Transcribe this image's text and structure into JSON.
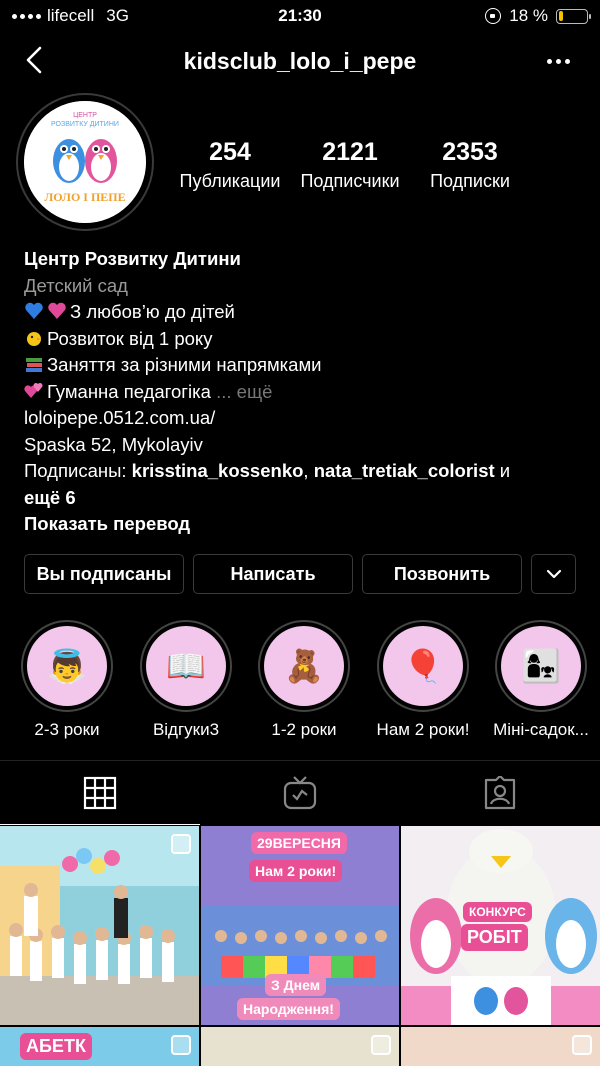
{
  "status_bar": {
    "carrier": "lifecell",
    "network": "3G",
    "time": "21:30",
    "battery_text": "18 %",
    "battery_level": 0.18
  },
  "header": {
    "username": "kidsclub_lolo_i_pepe"
  },
  "stats": [
    {
      "value": "254",
      "label": "Публикации"
    },
    {
      "value": "2121",
      "label": "Подписчики"
    },
    {
      "value": "2353",
      "label": "Подписки"
    }
  ],
  "bio": {
    "name": "Центр Розвитку Дитини",
    "category": "Детский сад",
    "lines": [
      "З любов’ю до дітей",
      "Розвиток від 1 року",
      "Заняття за різними напрямками",
      "Гуманна педагогіка"
    ],
    "more": "... ещё",
    "website": "loloipepe.0512.com.ua/",
    "address": "Spaska 52, Mykolayiv",
    "followed_by_prefix": "Подписаны: ",
    "followed_by_1": "krisstina_kossenko",
    "followed_by_sep": ", ",
    "followed_by_2": "nata_tretiak_colorist",
    "followed_by_suffix": " и",
    "followed_by_more": "ещё 6",
    "translate": "Показать перевод"
  },
  "buttons": {
    "following": "Вы подписаны",
    "message": "Написать",
    "call": "Позвонить",
    "chevron": "⌄"
  },
  "highlights": [
    {
      "label": "2-3 роки",
      "icon": "👼"
    },
    {
      "label": "Відгуки3",
      "icon": "📖"
    },
    {
      "label": "1-2 роки",
      "icon": "🧸"
    },
    {
      "label": "Нам 2 роки!",
      "icon": "🎈"
    },
    {
      "label": "Міні-садок...",
      "icon": "👩‍👧"
    }
  ],
  "tabs": [
    "grid-icon",
    "igtv-icon",
    "tagged-icon"
  ],
  "posts": {
    "post2_date": "29ВЕРЕСНЯ",
    "post2_title": "Нам 2 роки!",
    "post2_footer_1": "З Днем",
    "post2_footer_2": "Народження!",
    "post3_line1": "КОНКУРС",
    "post3_line2": "РОБІТ",
    "post4_text": "АБЕТК"
  },
  "logo": {
    "top": "ЦЕНТР",
    "mid": "РОЗВИТКУ ДИТИНИ",
    "bottom": "ЛОЛО І ПЕПЕ"
  },
  "colors": {
    "background": "#000000",
    "accent_pink": "#f06aa9",
    "battery": "#f5c400"
  }
}
